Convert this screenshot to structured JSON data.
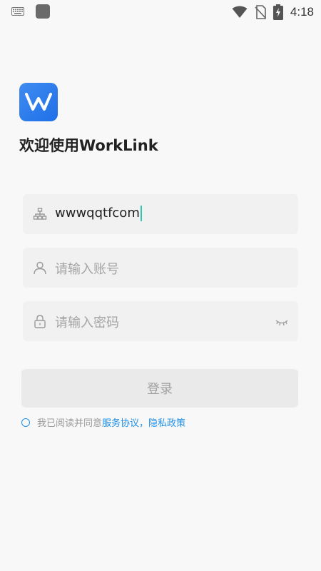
{
  "status_bar": {
    "time": "4:18",
    "icons": [
      "keyboard-icon",
      "app-square-icon",
      "wifi-icon",
      "no-sim-icon",
      "battery-charging-icon"
    ]
  },
  "app": {
    "welcome": "欢迎使用WorkLink"
  },
  "form": {
    "company_value": "wwwqqtfcom",
    "account_placeholder": "请输入账号",
    "password_placeholder": "请输入密码",
    "login_label": "登录"
  },
  "agreement": {
    "prefix": "我已阅读并同意",
    "service_link": "服务协议",
    "separator": "，",
    "privacy_link": "隐私政策"
  },
  "colors": {
    "accent": "#1f8fe8",
    "logo": "#2a7ef0",
    "caret": "#2dc6b0"
  }
}
